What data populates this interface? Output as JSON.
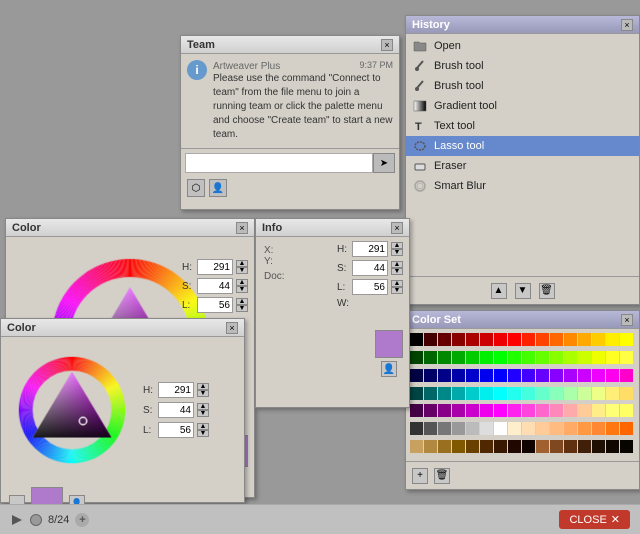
{
  "workspace": {
    "background": "#999999"
  },
  "history_panel": {
    "title": "History",
    "items": [
      {
        "id": "open",
        "label": "Open",
        "icon": "folder"
      },
      {
        "id": "brush1",
        "label": "Brush tool",
        "icon": "brush"
      },
      {
        "id": "brush2",
        "label": "Brush tool",
        "icon": "brush"
      },
      {
        "id": "gradient",
        "label": "Gradient tool",
        "icon": "gradient"
      },
      {
        "id": "text",
        "label": "Text tool",
        "icon": "text"
      },
      {
        "id": "lasso",
        "label": "Lasso tool",
        "icon": "lasso",
        "selected": true
      },
      {
        "id": "eraser",
        "label": "Eraser",
        "icon": "eraser"
      },
      {
        "id": "smartblur",
        "label": "Smart Blur",
        "icon": "blur"
      }
    ],
    "up_btn": "▲",
    "down_btn": "▼",
    "trash_btn": "🗑"
  },
  "colorset_panel": {
    "title": "Color Set",
    "colors": [
      "#000000",
      "#440000",
      "#660000",
      "#880000",
      "#aa0000",
      "#cc0000",
      "#ee0000",
      "#ff0000",
      "#ff2200",
      "#ff4400",
      "#ff6600",
      "#ff8800",
      "#ffaa00",
      "#ffcc00",
      "#ffee00",
      "#ffff00",
      "#004400",
      "#006600",
      "#008800",
      "#00aa00",
      "#00cc00",
      "#00ee00",
      "#00ff00",
      "#22ff00",
      "#44ff00",
      "#66ff00",
      "#88ff00",
      "#aaff00",
      "#ccff00",
      "#eeff00",
      "#ffff22",
      "#ffff44",
      "#000044",
      "#000066",
      "#000088",
      "#0000aa",
      "#0000cc",
      "#0000ee",
      "#0000ff",
      "#2200ff",
      "#4400ff",
      "#6600ff",
      "#8800ff",
      "#aa00ff",
      "#cc00ff",
      "#ee00ff",
      "#ff00ee",
      "#ff00cc",
      "#004444",
      "#006666",
      "#008888",
      "#00aaaa",
      "#00cccc",
      "#00eeee",
      "#00ffff",
      "#22ffee",
      "#44ffdd",
      "#66ffcc",
      "#88ffbb",
      "#aaffaa",
      "#ccff99",
      "#eeff88",
      "#ffee77",
      "#ffdd66",
      "#440044",
      "#660066",
      "#880088",
      "#aa00aa",
      "#cc00cc",
      "#ee00ee",
      "#ff00ff",
      "#ff22ee",
      "#ff44dd",
      "#ff66cc",
      "#ff88bb",
      "#ffaaaa",
      "#ffcc99",
      "#ffee88",
      "#ffff77",
      "#ffff66",
      "#333333",
      "#555555",
      "#777777",
      "#999999",
      "#bbbbbb",
      "#dddddd",
      "#ffffff",
      "#ffeecc",
      "#ffddb3",
      "#ffcc99",
      "#ffbb80",
      "#ffaa66",
      "#ff9944",
      "#ff8833",
      "#ff7711",
      "#ff6600",
      "#c8a060",
      "#b08840",
      "#987020",
      "#805800",
      "#684000",
      "#502800",
      "#381800",
      "#200800",
      "#100400",
      "#a06030",
      "#804820",
      "#603010",
      "#402008",
      "#201004",
      "#100800",
      "#080400"
    ]
  },
  "team_panel": {
    "title": "Team",
    "sender": "Artweaver Plus",
    "timestamp": "9:37 PM",
    "message": "Please use the command \"Connect to team\" from the file menu to join a running team or click the palette menu and choose \"Create team\" to start a new team.",
    "input_placeholder": "",
    "close_label": "×"
  },
  "color_panel_large": {
    "title": "Color",
    "h_label": "H:",
    "s_label": "S:",
    "l_label": "L:",
    "h_value": "291",
    "s_value": "44",
    "l_value": "56",
    "w_label": "W:",
    "color_preview": "#b07acc"
  },
  "color_panel_small": {
    "title": "Color",
    "h_label": "H:",
    "s_label": "S:",
    "l_label": "L:",
    "h_value": "291",
    "s_value": "44",
    "l_value": "56",
    "color_preview": "#b07acc"
  },
  "info_panel": {
    "title": "Info"
  },
  "bottom_bar": {
    "frame_count": "8/24",
    "close_label": "CLOSE",
    "close_icon": "✕"
  }
}
